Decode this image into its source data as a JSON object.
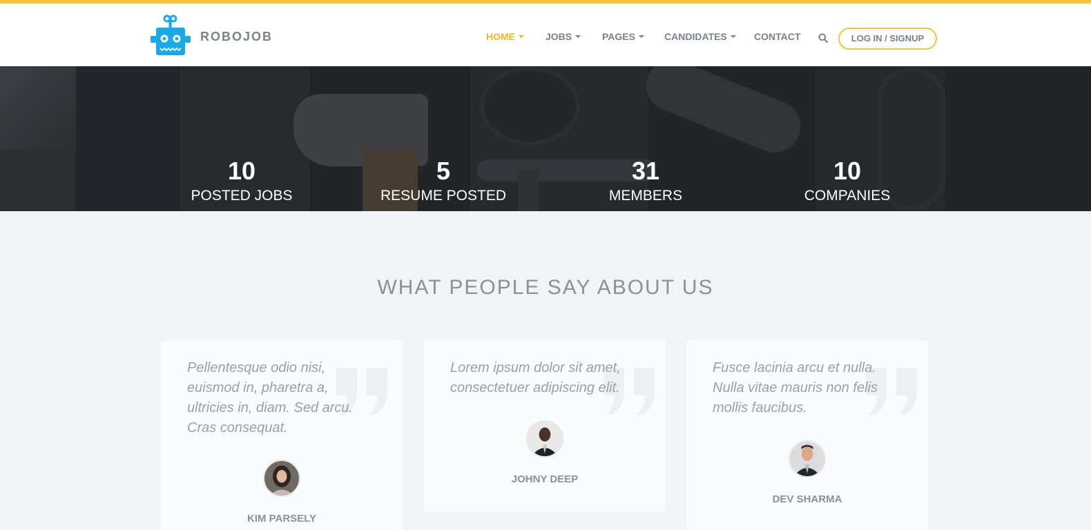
{
  "brand": {
    "name": "ROBOJOB",
    "logo_icon": "robot-icon",
    "accent_color": "#f2c23a",
    "logo_color": "#1aa9e8"
  },
  "nav": {
    "items": [
      {
        "label": "HOME",
        "dropdown": true,
        "active": true
      },
      {
        "label": "JOBS",
        "dropdown": true,
        "active": false
      },
      {
        "label": "PAGES",
        "dropdown": true,
        "active": false
      },
      {
        "label": "CANDIDATES",
        "dropdown": true,
        "active": false
      },
      {
        "label": "CONTACT",
        "dropdown": false,
        "active": false
      }
    ],
    "search_icon": "search-icon",
    "login_label": "LOG IN / SIGNUP"
  },
  "stats": [
    {
      "value": "10",
      "label": "POSTED JOBS"
    },
    {
      "value": "5",
      "label": "RESUME POSTED"
    },
    {
      "value": "31",
      "label": "MEMBERS"
    },
    {
      "value": "10",
      "label": "COMPANIES"
    }
  ],
  "testimonials": {
    "title": "WHAT PEOPLE SAY ABOUT US",
    "items": [
      {
        "quote": "Pellentesque odio nisi, euismod in, pharetra a, ultricies in, diam. Sed arcu. Cras consequat.",
        "name": "KIM PARSELY"
      },
      {
        "quote": "Lorem ipsum dolor sit amet, consectetuer adipiscing elit.",
        "name": "JOHNY DEEP"
      },
      {
        "quote": "Fusce lacinia arcu et nulla. Nulla vitae mauris non felis mollis faucibus.",
        "name": "DEV SHARMA"
      }
    ]
  }
}
